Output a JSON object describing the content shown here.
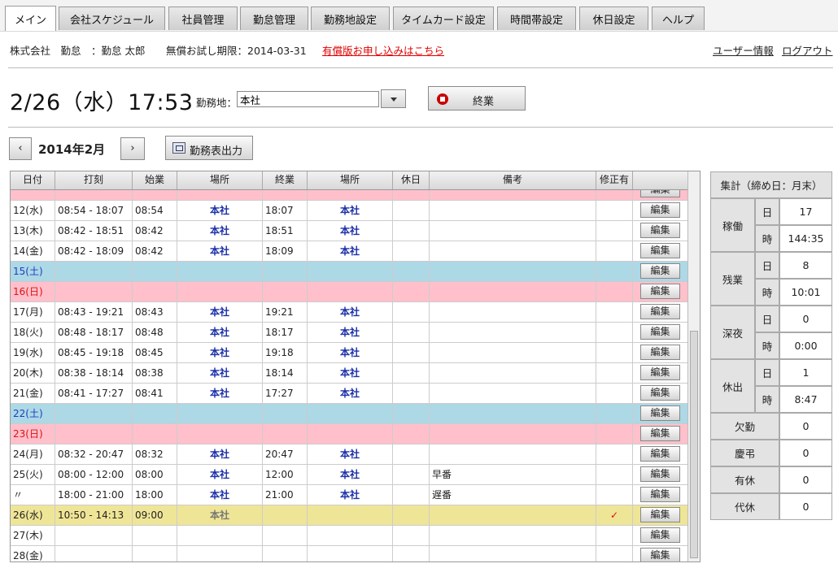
{
  "tabs": [
    "メイン",
    "会社スケジュール",
    "社員管理",
    "勤怠管理",
    "勤務地設定",
    "タイムカード設定",
    "時間帯設定",
    "休日設定",
    "ヘルプ"
  ],
  "header": {
    "company": "株式会社　勤怠",
    "user": "：勤怠 太郎",
    "trial": "無償お試し期限：2014-03-31",
    "upgrade_link": "有償版お申し込みはこちら",
    "user_info_link": "ユーザー情報",
    "logout_link": "ログアウト"
  },
  "status": {
    "datetime": "2/26（水）17:53",
    "location_label": "勤務地：",
    "location_value": "本社",
    "end_button": "終業"
  },
  "calendar": {
    "prev": "‹",
    "next": "›",
    "month": "2014年2月",
    "export_button": "勤務表出力"
  },
  "table": {
    "headers": [
      "日付",
      "打刻",
      "始業",
      "場所",
      "終業",
      "場所",
      "休日",
      "備考",
      "修正有"
    ],
    "edit_label": "編集",
    "rows": [
      {
        "date": "",
        "stamp": "",
        "start": "",
        "place1": "",
        "end": "",
        "place2": "",
        "holiday": "",
        "note": "",
        "fixed": "",
        "type": "sun"
      },
      {
        "date": "12(水)",
        "stamp": "08:54 - 18:07",
        "start": "08:54",
        "place1": "本社",
        "end": "18:07",
        "place2": "本社",
        "holiday": "",
        "note": "",
        "fixed": "",
        "type": "normal"
      },
      {
        "date": "13(木)",
        "stamp": "08:42 - 18:51",
        "start": "08:42",
        "place1": "本社",
        "end": "18:51",
        "place2": "本社",
        "holiday": "",
        "note": "",
        "fixed": "",
        "type": "normal"
      },
      {
        "date": "14(金)",
        "stamp": "08:42 - 18:09",
        "start": "08:42",
        "place1": "本社",
        "end": "18:09",
        "place2": "本社",
        "holiday": "",
        "note": "",
        "fixed": "",
        "type": "normal"
      },
      {
        "date": "15(土)",
        "stamp": "",
        "start": "",
        "place1": "",
        "end": "",
        "place2": "",
        "holiday": "",
        "note": "",
        "fixed": "",
        "type": "sat"
      },
      {
        "date": "16(日)",
        "stamp": "",
        "start": "",
        "place1": "",
        "end": "",
        "place2": "",
        "holiday": "",
        "note": "",
        "fixed": "",
        "type": "sun"
      },
      {
        "date": "17(月)",
        "stamp": "08:43 - 19:21",
        "start": "08:43",
        "place1": "本社",
        "end": "19:21",
        "place2": "本社",
        "holiday": "",
        "note": "",
        "fixed": "",
        "type": "normal"
      },
      {
        "date": "18(火)",
        "stamp": "08:48 - 18:17",
        "start": "08:48",
        "place1": "本社",
        "end": "18:17",
        "place2": "本社",
        "holiday": "",
        "note": "",
        "fixed": "",
        "type": "normal"
      },
      {
        "date": "19(水)",
        "stamp": "08:45 - 19:18",
        "start": "08:45",
        "place1": "本社",
        "end": "19:18",
        "place2": "本社",
        "holiday": "",
        "note": "",
        "fixed": "",
        "type": "normal"
      },
      {
        "date": "20(木)",
        "stamp": "08:38 - 18:14",
        "start": "08:38",
        "place1": "本社",
        "end": "18:14",
        "place2": "本社",
        "holiday": "",
        "note": "",
        "fixed": "",
        "type": "normal"
      },
      {
        "date": "21(金)",
        "stamp": "08:41 - 17:27",
        "start": "08:41",
        "place1": "本社",
        "end": "17:27",
        "place2": "本社",
        "holiday": "",
        "note": "",
        "fixed": "",
        "type": "normal"
      },
      {
        "date": "22(土)",
        "stamp": "",
        "start": "",
        "place1": "",
        "end": "",
        "place2": "",
        "holiday": "",
        "note": "",
        "fixed": "",
        "type": "sat"
      },
      {
        "date": "23(日)",
        "stamp": "",
        "start": "",
        "place1": "",
        "end": "",
        "place2": "",
        "holiday": "",
        "note": "",
        "fixed": "",
        "type": "sun"
      },
      {
        "date": "24(月)",
        "stamp": "08:32 - 20:47",
        "start": "08:32",
        "place1": "本社",
        "end": "20:47",
        "place2": "本社",
        "holiday": "",
        "note": "",
        "fixed": "",
        "type": "normal"
      },
      {
        "date": "25(火)",
        "stamp": "08:00 - 12:00",
        "start": "08:00",
        "place1": "本社",
        "end": "12:00",
        "place2": "本社",
        "holiday": "",
        "note": "早番",
        "fixed": "",
        "type": "normal"
      },
      {
        "date": "〃",
        "stamp": "18:00 - 21:00",
        "start": "18:00",
        "place1": "本社",
        "end": "21:00",
        "place2": "本社",
        "holiday": "",
        "note": "遅番",
        "fixed": "",
        "type": "normal"
      },
      {
        "date": "26(水)",
        "stamp": "10:50 - 14:13",
        "start": "09:00",
        "place1": "本社",
        "end": "",
        "place2": "",
        "holiday": "",
        "note": "",
        "fixed": "✓",
        "type": "today"
      },
      {
        "date": "27(木)",
        "stamp": "",
        "start": "",
        "place1": "",
        "end": "",
        "place2": "",
        "holiday": "",
        "note": "",
        "fixed": "",
        "type": "normal"
      },
      {
        "date": "28(金)",
        "stamp": "",
        "start": "",
        "place1": "",
        "end": "",
        "place2": "",
        "holiday": "",
        "note": "",
        "fixed": "",
        "type": "normal"
      }
    ]
  },
  "summary": {
    "title": "集計（締め日：月末）",
    "groups": [
      {
        "label": "稼働",
        "day_label": "日",
        "day": "17",
        "time_label": "時",
        "time": "144:35"
      },
      {
        "label": "残業",
        "day_label": "日",
        "day": "8",
        "time_label": "時",
        "time": "10:01"
      },
      {
        "label": "深夜",
        "day_label": "日",
        "day": "0",
        "time_label": "時",
        "time": "0:00"
      },
      {
        "label": "休出",
        "day_label": "日",
        "day": "1",
        "time_label": "時",
        "time": "8:47"
      }
    ],
    "singles": [
      {
        "label": "欠勤",
        "value": "0"
      },
      {
        "label": "慶弔",
        "value": "0"
      },
      {
        "label": "有休",
        "value": "0"
      },
      {
        "label": "代休",
        "value": "0"
      }
    ]
  },
  "colors": {
    "saturday_row": "#add8e6",
    "sunday_row": "#ffc0cb",
    "today_row": "#efe597",
    "place_text": "#1a2fa8",
    "upgrade_link": "#e00000"
  }
}
